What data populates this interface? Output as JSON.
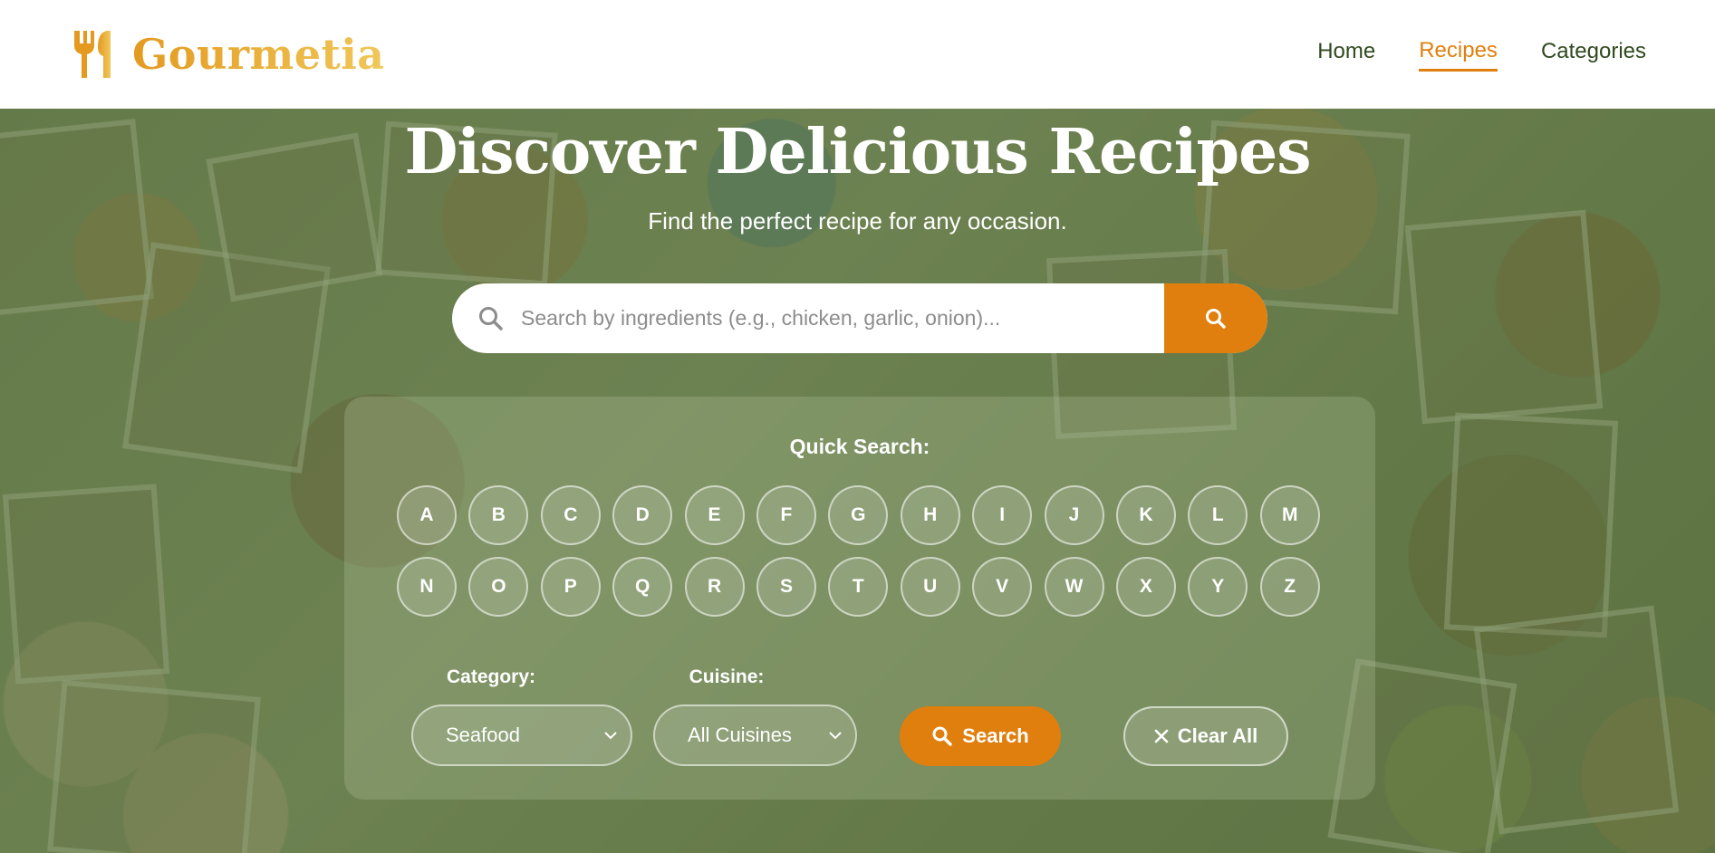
{
  "brand": {
    "name": "Gourmetia",
    "accent": "#e07f0e",
    "logo_icon": "fork-spoon-icon"
  },
  "nav": {
    "items": [
      {
        "label": "Home",
        "active": false
      },
      {
        "label": "Recipes",
        "active": true
      },
      {
        "label": "Categories",
        "active": false
      }
    ]
  },
  "hero": {
    "title": "Discover Delicious Recipes",
    "subtitle": "Find the perfect recipe for any occasion."
  },
  "search": {
    "placeholder": "Search by ingredients (e.g., chicken, garlic, onion)...",
    "value": "",
    "icon": "search-icon"
  },
  "quick_search": {
    "title": "Quick Search:",
    "letters": [
      "A",
      "B",
      "C",
      "D",
      "E",
      "F",
      "G",
      "H",
      "I",
      "J",
      "K",
      "L",
      "M",
      "N",
      "O",
      "P",
      "Q",
      "R",
      "S",
      "T",
      "U",
      "V",
      "W",
      "X",
      "Y",
      "Z"
    ],
    "category": {
      "label": "Category:",
      "selected": "Seafood"
    },
    "cuisine": {
      "label": "Cuisine:",
      "selected": "All Cuisines"
    },
    "search_button": "Search",
    "clear_button": "Clear All"
  }
}
